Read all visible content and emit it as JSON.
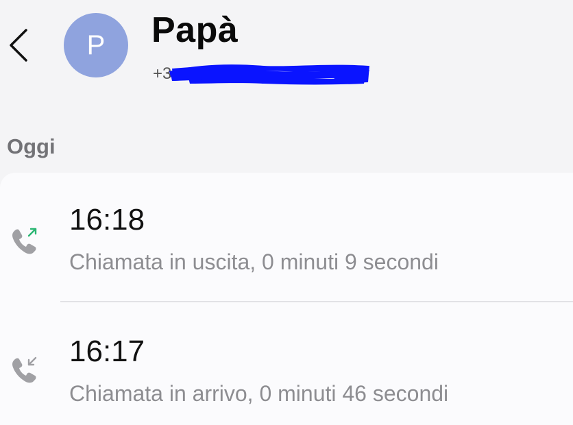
{
  "header": {
    "avatar_initial": "P",
    "contact_name": "Papà",
    "phone_visible": "+3"
  },
  "section": {
    "label": "Oggi"
  },
  "calls": [
    {
      "time": "16:18",
      "detail": "Chiamata in uscita, 0 minuti 9 secondi",
      "icon": "outgoing-call-icon",
      "arrow_color": "#2bb673"
    },
    {
      "time": "16:17",
      "detail": "Chiamata in arrivo, 0 minuti 46 secondi",
      "icon": "incoming-call-icon",
      "arrow_color": "#a0a0a4"
    }
  ],
  "colors": {
    "avatar_bg": "#8fa3de",
    "redaction": "#0a14ff",
    "icon_gray": "#a0a0a4"
  }
}
